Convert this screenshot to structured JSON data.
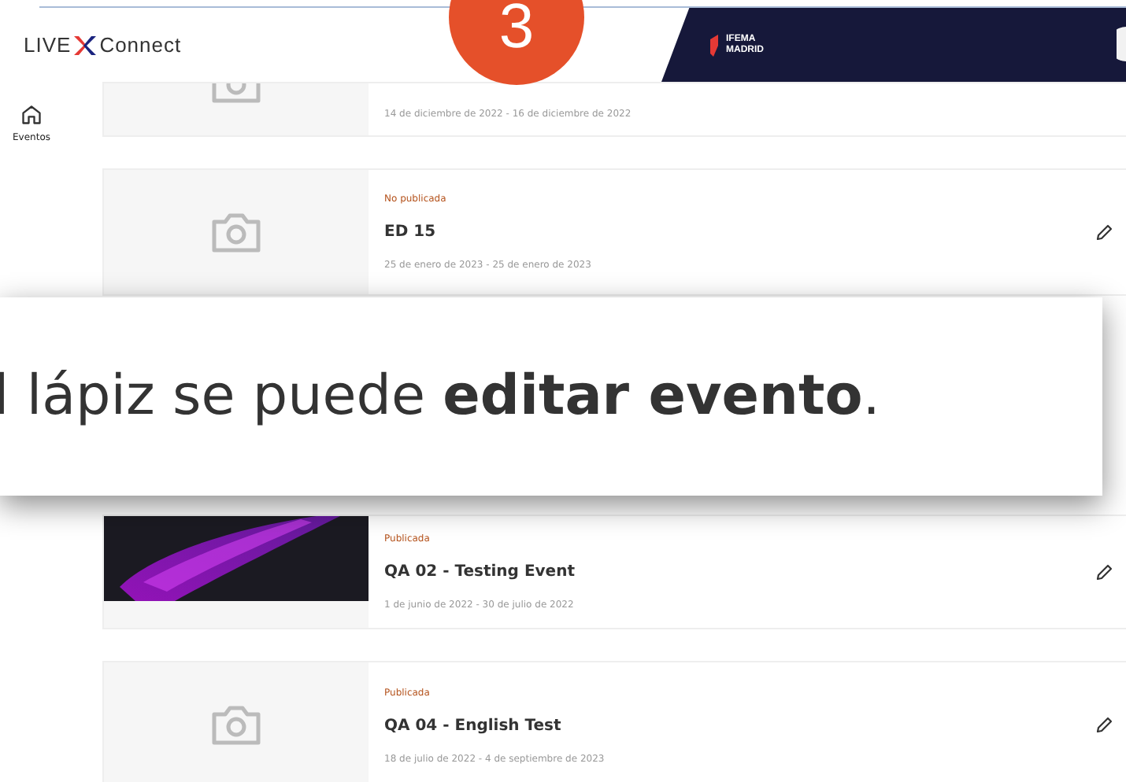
{
  "header": {
    "logo_left": "LIVE",
    "logo_right": "Connect",
    "banner_logo": [
      "IFEMA",
      "MADRID"
    ]
  },
  "step_badge": "3",
  "sidebar": {
    "items": [
      {
        "label": "Eventos",
        "selected": true
      }
    ]
  },
  "events": [
    {
      "kind": "cut",
      "date": "14 de diciembre de 2022 - 16 de diciembre de 2022"
    },
    {
      "kind": "placeholder",
      "status": "No publicada",
      "title": "ED 15",
      "date": "25 de enero de 2023 - 25 de enero de 2023"
    },
    {
      "kind": "picture",
      "status": "Publicada",
      "title": "QA 02 - Testing Event",
      "date": "1 de junio de 2022 - 30 de julio de 2022"
    },
    {
      "kind": "placeholder",
      "status": "Publicada",
      "title": "QA 04 - English Test",
      "date": "18 de julio de 2022 - 4 de septiembre de 2023"
    }
  ],
  "callout": {
    "text": "l lápiz se puede **editar evento**."
  }
}
